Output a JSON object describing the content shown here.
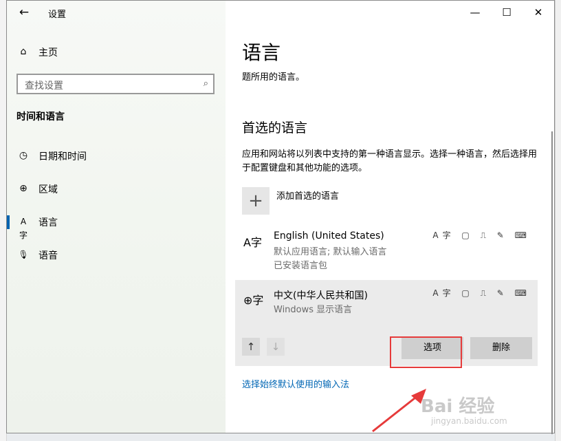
{
  "window": {
    "title": "设置",
    "back_icon": "←",
    "minimize_icon": "—",
    "maximize_icon": "☐",
    "close_icon": "✕"
  },
  "sidebar": {
    "home": {
      "icon": "⌂",
      "label": "主页"
    },
    "search": {
      "placeholder": "查找设置",
      "icon": "⌕"
    },
    "section_title": "时间和语言",
    "items": [
      {
        "icon": "◷",
        "label": "日期和时间",
        "active": false
      },
      {
        "icon": "⊕",
        "label": "区域",
        "active": false
      },
      {
        "icon": "A字",
        "label": "语言",
        "active": true
      },
      {
        "icon": "🎙",
        "label": "语音",
        "active": false
      }
    ]
  },
  "main": {
    "title": "语言",
    "subtitle": "题所用的语言。",
    "preferred_heading": "首选的语言",
    "preferred_desc": "应用和网站将以列表中支持的第一种语言显示。选择一种语言，然后选择用于配置键盘和其他功能的选项。",
    "add_icon": "+",
    "add_label": "添加首选的语言",
    "languages": [
      {
        "icon": "A字",
        "name": "English (United States)",
        "line2": "默认应用语言; 默认输入语言",
        "line3": "已安装语言包",
        "feature_icons": "A字 ▢ ⎍ ✎ ⌨"
      },
      {
        "icon": "⊕字",
        "name": "中文(中华人民共和国)",
        "line2": "Windows 显示语言",
        "line3": "",
        "feature_icons": "A字 ▢ ⎍ ✎ ⌨"
      }
    ],
    "move_up_icon": "↑",
    "move_down_icon": "↓",
    "options_label": "选项",
    "remove_label": "删除",
    "input_link": "选择始终默认使用的输入法"
  },
  "watermark": {
    "text": "Bai 经验",
    "sub": "jingyan.baidu.com"
  },
  "colors": {
    "accent": "#0063b1",
    "link": "#0066b4",
    "highlight": "#e63a3a"
  }
}
